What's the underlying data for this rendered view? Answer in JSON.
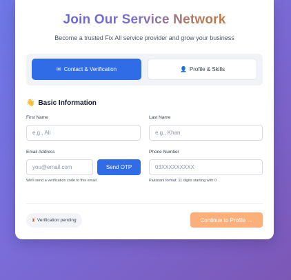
{
  "header": {
    "title": "Join Our Service Network",
    "subtitle": "Become a trusted Fix All service provider and grow your business"
  },
  "tabs": [
    {
      "label": "Contact & Verification",
      "icon": "envelope-icon",
      "active": true
    },
    {
      "label": "Profile & Skills",
      "icon": "person-icon",
      "active": false
    }
  ],
  "section": {
    "title": "Basic Information",
    "icon": "waving-hand-icon"
  },
  "fields": {
    "first_name": {
      "label": "First Name",
      "placeholder": "e.g., Ali",
      "value": ""
    },
    "last_name": {
      "label": "Last Name",
      "placeholder": "e.g., Khan",
      "value": ""
    },
    "email": {
      "label": "Email Address",
      "placeholder": "you@email.com",
      "value": "",
      "hint": "We'll send a verification code to this email"
    },
    "phone": {
      "label": "Phone Number",
      "placeholder": "03XXXXXXXXX",
      "value": "",
      "hint": "Pakistani format: 11 digits starting with 0"
    }
  },
  "buttons": {
    "send_otp": "Send OTP",
    "continue": "Continue to Profile →"
  },
  "status": {
    "verification": "Verification pending",
    "icon": "hourglass-icon"
  },
  "colors": {
    "primary": "#2f6ce6",
    "accent_orange": "#fbb07c",
    "background_start": "#6d78e6",
    "background_end": "#7c57b6"
  }
}
